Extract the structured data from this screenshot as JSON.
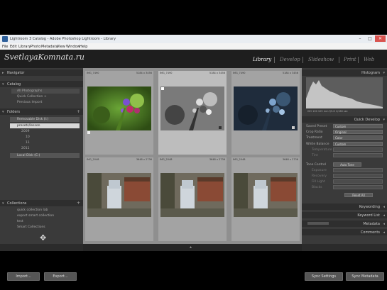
{
  "window": {
    "title": "Lightroom 3 Catalog - Adobe Photoshop Lightroom - Library",
    "controls": [
      "–",
      "□",
      "✕"
    ]
  },
  "menu": [
    "File",
    "Edit",
    "Library",
    "Photo",
    "Metadata",
    "View",
    "Window",
    "Help"
  ],
  "identity_plate": "SvetlayaKomnata.ru",
  "modules": [
    "Library",
    "Develop",
    "Slideshow",
    "Print",
    "Web"
  ],
  "left_panel": {
    "navigator": "Navigator",
    "catalog": {
      "title": "Catalog",
      "items": [
        {
          "label": "All Photographs",
          "count": ""
        },
        {
          "label": "Quick Collection +",
          "count": ""
        },
        {
          "label": "Previous Import",
          "count": ""
        }
      ]
    },
    "folders": {
      "title": "Folders",
      "volume": "Removable Disk (I:)",
      "items": [
        {
          "label": "presets/lesson",
          "count": ""
        },
        {
          "label": "2009",
          "count": ""
        },
        {
          "label": "10",
          "count": ""
        },
        {
          "label": "11",
          "count": ""
        },
        {
          "label": "2011",
          "count": ""
        }
      ],
      "volume2": "Local Disk (C:)"
    },
    "collections": {
      "title": "Collections",
      "items": [
        {
          "label": "quick collection lab",
          "count": ""
        },
        {
          "label": "export smart collection",
          "count": ""
        },
        {
          "label": "test",
          "count": ""
        },
        {
          "label": "Smart Collections",
          "count": ""
        }
      ]
    },
    "import_label": "Import...",
    "export_label": "Export..."
  },
  "grid": {
    "cells": [
      {
        "meta": "IMG_7490",
        "meta2": "5184 x 3456"
      },
      {
        "meta": "IMG_7490",
        "meta2": "5184 x 3456"
      },
      {
        "meta": "IMG_7490",
        "meta2": "5184 x 3456"
      },
      {
        "meta": "IMG_2048",
        "meta2": "3648 x 2736"
      },
      {
        "meta": "IMG_2048",
        "meta2": "3648 x 2736"
      },
      {
        "meta": "IMG_2048",
        "meta2": "3648 x 2736"
      }
    ]
  },
  "right_panel": {
    "histogram": "Histogram",
    "histogram_readout": "ISO 100   105 mm   f/5.6   1/160 sec",
    "quick_develop": "Quick Develop",
    "saved_preset_label": "Saved Preset",
    "saved_preset_value": "Custom",
    "crop_ratio_label": "Crop Ratio",
    "crop_ratio_value": "Original",
    "treatment_label": "Treatment",
    "treatment_value": "Color",
    "wb_label": "White Balance",
    "wb_value": "Custom",
    "temp_label": "Temperature",
    "tint_label": "Tint",
    "tone_control_label": "Tone Control",
    "auto_tone_label": "Auto Tone",
    "exposure_label": "Exposure",
    "recovery_label": "Recovery",
    "fill_light_label": "Fill Light",
    "blacks_label": "Blacks",
    "brightness_label": "Brightness",
    "contrast_label": "Contrast",
    "clarity_label": "Clarity",
    "vibrance_label": "Vibrance",
    "reset_all_label": "Reset All",
    "keywording": "Keywording",
    "keyword_list": "Keyword List",
    "metadata": "Metadata",
    "comments": "Comments",
    "sync_settings_label": "Sync Settings",
    "sync_metadata_label": "Sync Metadata"
  }
}
